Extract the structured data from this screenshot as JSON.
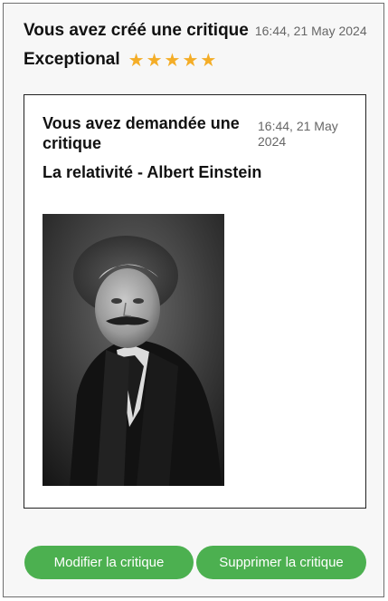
{
  "review": {
    "title": "Vous avez créé une critique",
    "timestamp": "16:44, 21 May 2024",
    "rating_label": "Exceptional",
    "rating": 5,
    "rating_max": 5,
    "star_icon": "star-icon",
    "star_color": "#f4ad27"
  },
  "ticket": {
    "title": "Vous avez demandée une critique",
    "timestamp": "16:44, 21 May 2024",
    "book_title": "La relativité - Albert Einstein"
  },
  "actions": {
    "edit_label": "Modifier la critique",
    "delete_label": "Supprimer la critique",
    "button_color": "#4cb050"
  }
}
